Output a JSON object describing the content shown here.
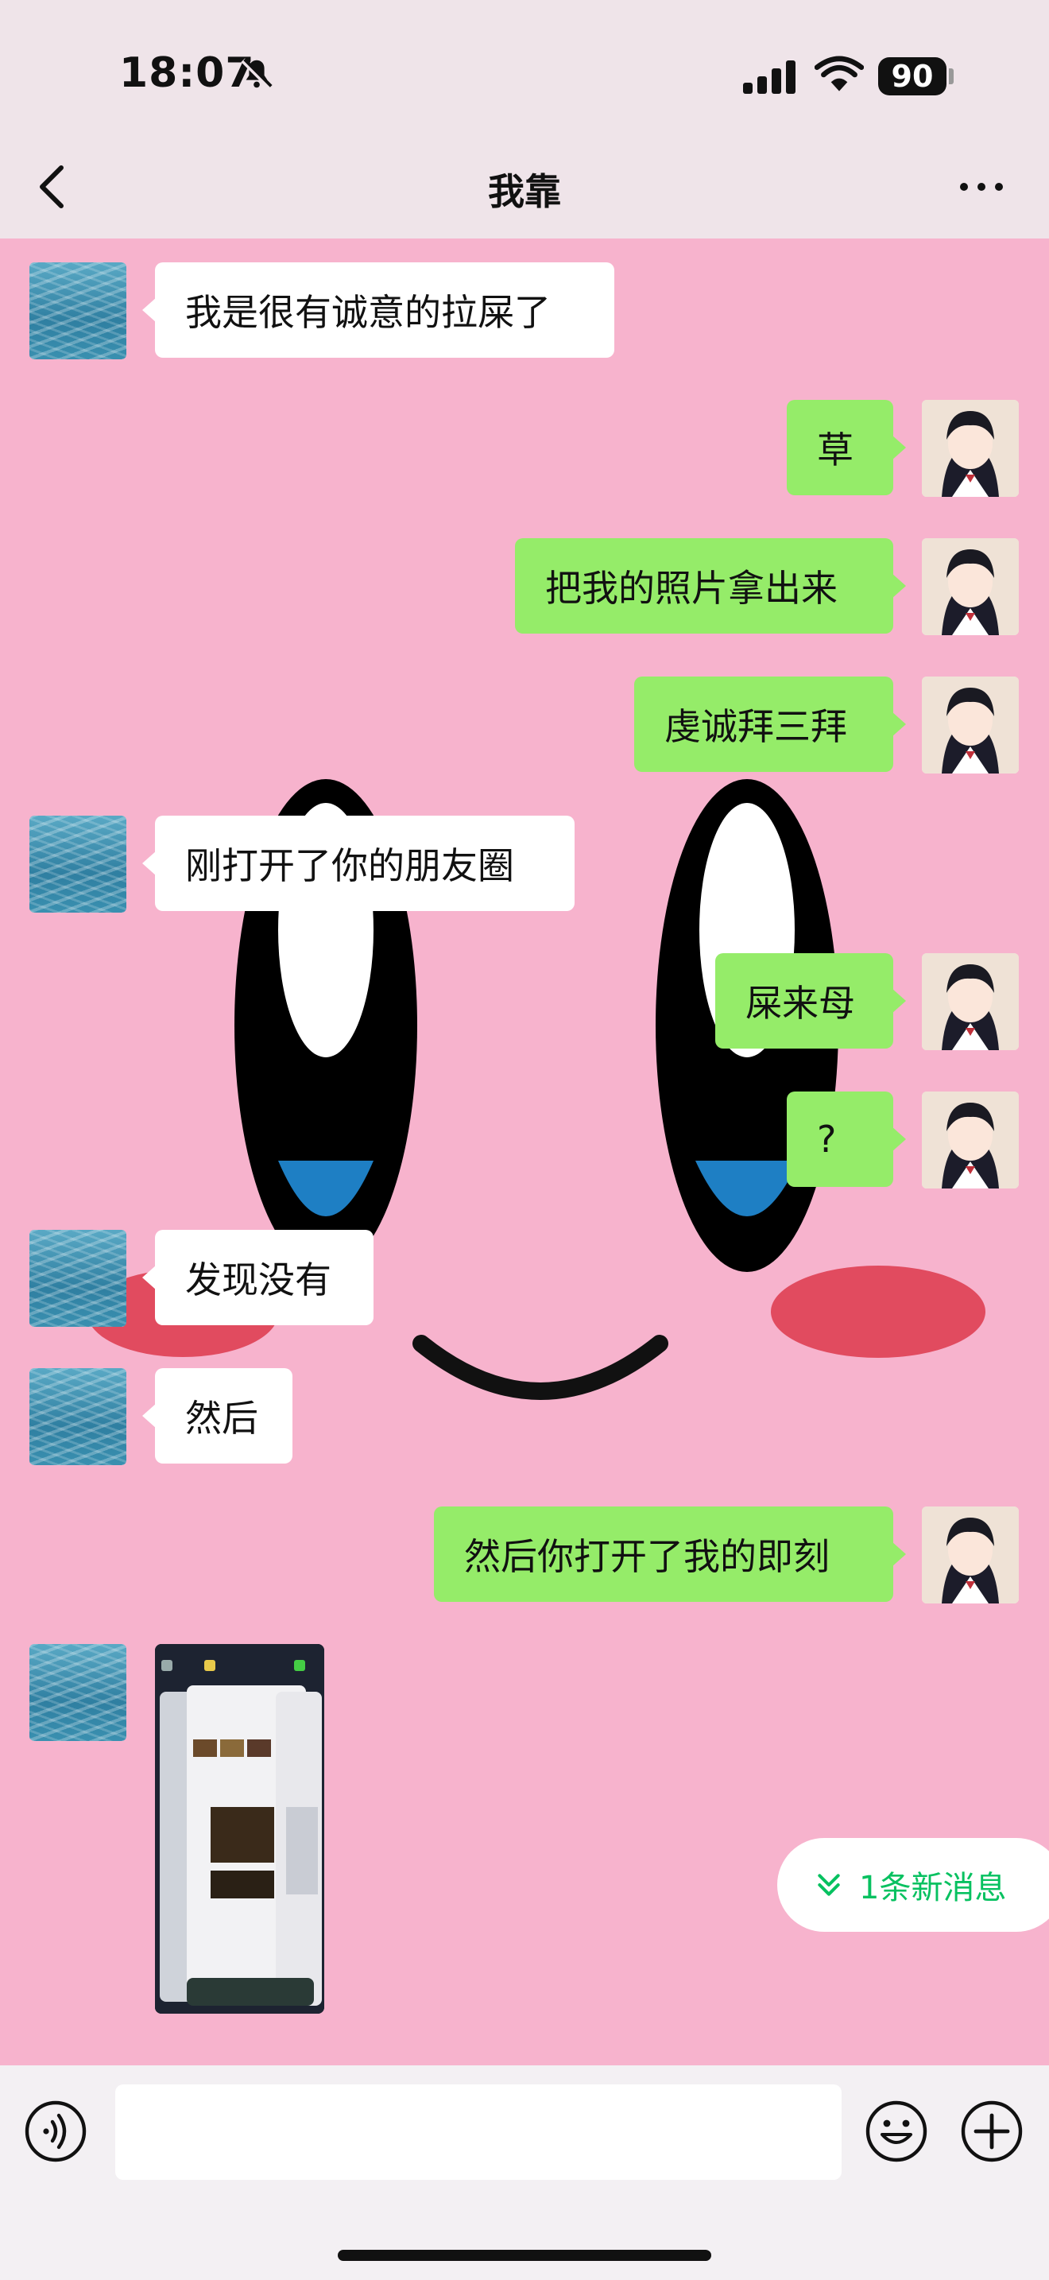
{
  "status_bar": {
    "time": "18:07",
    "battery": "90"
  },
  "header": {
    "title": "我靠"
  },
  "messages": [
    {
      "side": "in",
      "text": "我是很有诚意的拉屎了"
    },
    {
      "side": "out",
      "text": "草"
    },
    {
      "side": "out",
      "text": "把我的照片拿出来"
    },
    {
      "side": "out",
      "text": "虔诚拜三拜"
    },
    {
      "side": "in",
      "text": "刚打开了你的朋友圈"
    },
    {
      "side": "out",
      "text": "屎来母"
    },
    {
      "side": "out",
      "text": "?"
    },
    {
      "side": "in",
      "text": "发现没有"
    },
    {
      "side": "in",
      "text": "然后"
    },
    {
      "side": "out",
      "text": "然后你打开了我的即刻"
    },
    {
      "side": "in",
      "type": "image"
    }
  ],
  "new_message_pill": {
    "label": "1条新消息"
  },
  "input_bar": {
    "placeholder": ""
  },
  "colors": {
    "incoming_bubble": "#ffffff",
    "outgoing_bubble": "#95ec69",
    "accent": "#07c160",
    "background": "#f7b3cd"
  }
}
